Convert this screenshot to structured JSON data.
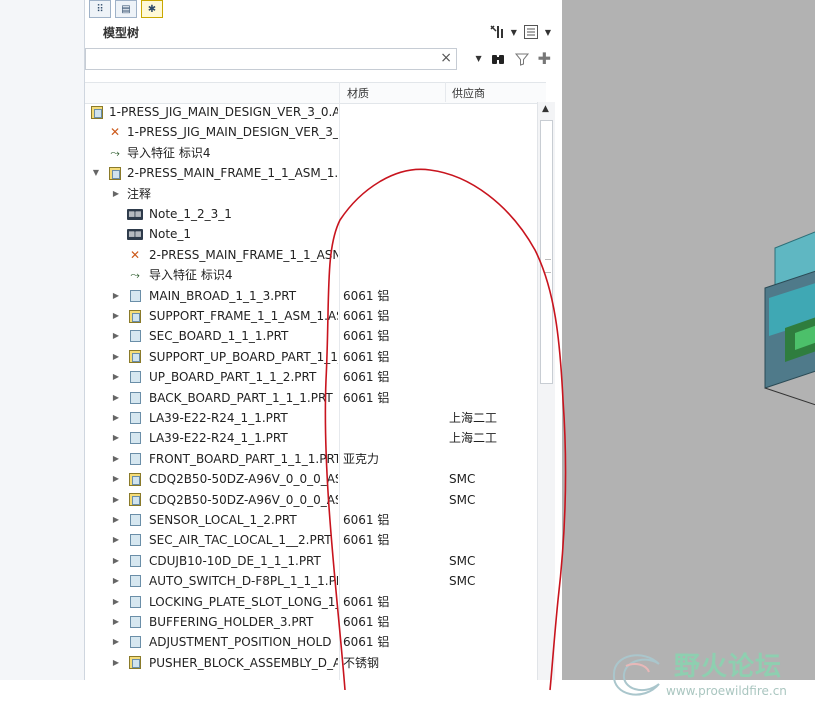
{
  "tabs": [
    {
      "icon": "tree-view-icon"
    },
    {
      "icon": "layer-tree-icon"
    },
    {
      "icon": "favorites-icon"
    }
  ],
  "tree_header": {
    "title": "模型树",
    "tools": [
      "tree-settings-icon",
      "show-columns-icon"
    ]
  },
  "search": {
    "value": "",
    "placeholder": "",
    "clear_icon": "close-icon",
    "tools": [
      "find-binoculars-icon",
      "filter-icon",
      "add-icon"
    ]
  },
  "columns": {
    "material": "材质",
    "supplier": "供应商"
  },
  "rows": [
    {
      "indent": 0,
      "exp": "",
      "icon": "asm",
      "label": "1-PRESS_JIG_MAIN_DESIGN_VER_3_0.AS",
      "mat": "",
      "sup": ""
    },
    {
      "indent": 1,
      "exp": "",
      "icon": "feat",
      "label": "1-PRESS_JIG_MAIN_DESIGN_VER_3_",
      "mat": "",
      "sup": ""
    },
    {
      "indent": 1,
      "exp": "",
      "icon": "imp",
      "label": "导入特征 标识4",
      "mat": "",
      "sup": ""
    },
    {
      "indent": 1,
      "exp": "down",
      "icon": "asm",
      "label": "2-PRESS_MAIN_FRAME_1_1_ASM_1.",
      "mat": "",
      "sup": ""
    },
    {
      "indent": 2,
      "exp": "right",
      "icon": "none",
      "label": "注释",
      "mat": "",
      "sup": ""
    },
    {
      "indent": 2,
      "exp": "",
      "icon": "note",
      "label": "Note_1_2_3_1",
      "mat": "",
      "sup": ""
    },
    {
      "indent": 2,
      "exp": "",
      "icon": "note",
      "label": "Note_1",
      "mat": "",
      "sup": ""
    },
    {
      "indent": 2,
      "exp": "",
      "icon": "feat",
      "label": "2-PRESS_MAIN_FRAME_1_1_ASN",
      "mat": "",
      "sup": ""
    },
    {
      "indent": 2,
      "exp": "",
      "icon": "imp",
      "label": "导入特征 标识4",
      "mat": "",
      "sup": ""
    },
    {
      "indent": 2,
      "exp": "right",
      "icon": "part",
      "label": "MAIN_BROAD_1_1_3.PRT",
      "mat": "6061 铝",
      "sup": ""
    },
    {
      "indent": 2,
      "exp": "right",
      "icon": "asm",
      "label": "SUPPORT_FRAME_1_1_ASM_1.AS",
      "mat": "6061 铝",
      "sup": ""
    },
    {
      "indent": 2,
      "exp": "right",
      "icon": "part",
      "label": "SEC_BOARD_1_1_1.PRT",
      "mat": "6061 铝",
      "sup": ""
    },
    {
      "indent": 2,
      "exp": "right",
      "icon": "asm",
      "label": "SUPPORT_UP_BOARD_PART_1_1_",
      "mat": "6061 铝",
      "sup": ""
    },
    {
      "indent": 2,
      "exp": "right",
      "icon": "part",
      "label": "UP_BOARD_PART_1_1_2.PRT",
      "mat": "6061 铝",
      "sup": ""
    },
    {
      "indent": 2,
      "exp": "right",
      "icon": "part",
      "label": "BACK_BOARD_PART_1_1_1.PRT",
      "mat": "6061 铝",
      "sup": ""
    },
    {
      "indent": 2,
      "exp": "right",
      "icon": "part",
      "label": "LA39-E22-R24_1_1.PRT",
      "mat": "",
      "sup": "上海二工"
    },
    {
      "indent": 2,
      "exp": "right",
      "icon": "part",
      "label": "LA39-E22-R24_1_1.PRT",
      "mat": "",
      "sup": "上海二工"
    },
    {
      "indent": 2,
      "exp": "right",
      "icon": "part",
      "label": "FRONT_BOARD_PART_1_1_1.PRT",
      "mat": "亚克力",
      "sup": ""
    },
    {
      "indent": 2,
      "exp": "right",
      "icon": "asm",
      "label": "CDQ2B50-50DZ-A96V_0_0_0_ASI",
      "mat": "",
      "sup": "SMC"
    },
    {
      "indent": 2,
      "exp": "right",
      "icon": "asm",
      "label": "CDQ2B50-50DZ-A96V_0_0_0_ASI",
      "mat": "",
      "sup": "SMC"
    },
    {
      "indent": 2,
      "exp": "right",
      "icon": "part",
      "label": "SENSOR_LOCAL_1_2.PRT",
      "mat": "6061 铝",
      "sup": ""
    },
    {
      "indent": 2,
      "exp": "right",
      "icon": "part",
      "label": "SEC_AIR_TAC_LOCAL_1__2.PRT",
      "mat": "6061 铝",
      "sup": ""
    },
    {
      "indent": 2,
      "exp": "right",
      "icon": "part",
      "label": "CDUJB10-10D_DE_1_1_1.PRT",
      "mat": "",
      "sup": "SMC"
    },
    {
      "indent": 2,
      "exp": "right",
      "icon": "part",
      "label": "AUTO_SWITCH_D-F8PL_1_1_1.PR",
      "mat": "",
      "sup": "SMC"
    },
    {
      "indent": 2,
      "exp": "right",
      "icon": "part",
      "label": "LOCKING_PLATE_SLOT_LONG_1_",
      "mat": "6061 铝",
      "sup": ""
    },
    {
      "indent": 2,
      "exp": "right",
      "icon": "part",
      "label": "BUFFERING_HOLDER_3.PRT",
      "mat": "6061 铝",
      "sup": ""
    },
    {
      "indent": 2,
      "exp": "right",
      "icon": "part",
      "label": "ADJUSTMENT_POSITION_HOLD",
      "mat": "6061 铝",
      "sup": ""
    },
    {
      "indent": 2,
      "exp": "right",
      "icon": "asm",
      "label": "PUSHER_BLOCK_ASSEMBLY_D_A",
      "mat": "不锈钢",
      "sup": ""
    }
  ],
  "watermark": {
    "text": "野火论坛",
    "url": "www.proewildfire.cn"
  },
  "colors": {
    "viewport_bg": "#b2b2b2",
    "annotation": "#c8141e",
    "watermark": "#8ecfb0"
  }
}
